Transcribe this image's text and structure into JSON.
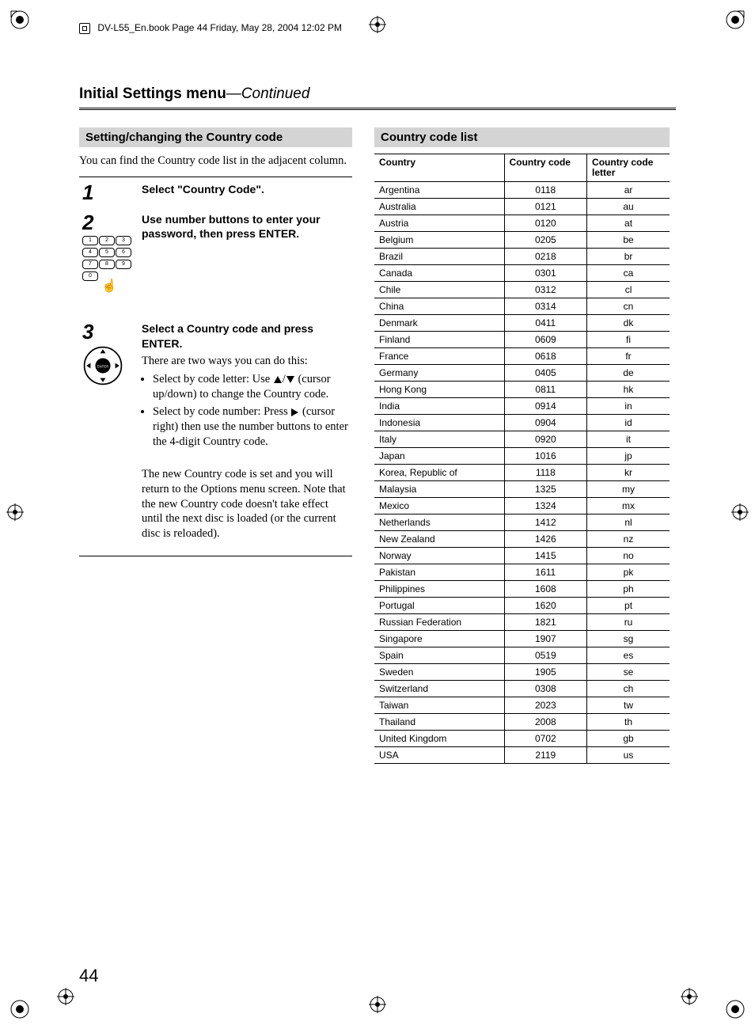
{
  "header_note": "DV-L55_En.book  Page 44  Friday, May 28, 2004  12:02 PM",
  "running_title_bold": "Initial Settings menu",
  "running_title_cont": "—Continued",
  "page_number": "44",
  "left": {
    "heading": "Setting/changing the Country code",
    "intro": "You can find the Country code list in the adjacent column.",
    "step1_num": "1",
    "step1_title": "Select \"Country Code\".",
    "step2_num": "2",
    "step2_title": "Use number buttons to enter your password, then press ENTER.",
    "step3_num": "3",
    "step3_title": "Select a Country code and press ENTER.",
    "step3_lead": "There are two ways you can do this:",
    "step3_b1_a": "Select by code letter: Use ",
    "step3_b1_b": " (cursor up/down) to change the Country code.",
    "step3_b2_a": "Select by code number: Press ",
    "step3_b2_b": " (cursor right) then use the number buttons to enter the 4-digit Country code.",
    "step3_para2": "The new Country code is set and you will return to the Options menu screen. Note that the new Country code doesn't take effect until the next disc is loaded (or the current disc is reloaded)."
  },
  "right": {
    "heading": "Country code list",
    "th1": "Country",
    "th2": "Country code",
    "th3": "Country code letter",
    "rows": [
      {
        "c": "Argentina",
        "n": "0118",
        "l": "ar"
      },
      {
        "c": "Australia",
        "n": "0121",
        "l": "au"
      },
      {
        "c": "Austria",
        "n": "0120",
        "l": "at"
      },
      {
        "c": "Belgium",
        "n": "0205",
        "l": "be"
      },
      {
        "c": "Brazil",
        "n": "0218",
        "l": "br"
      },
      {
        "c": "Canada",
        "n": "0301",
        "l": "ca"
      },
      {
        "c": "Chile",
        "n": "0312",
        "l": "cl"
      },
      {
        "c": "China",
        "n": "0314",
        "l": "cn"
      },
      {
        "c": "Denmark",
        "n": "0411",
        "l": "dk"
      },
      {
        "c": "Finland",
        "n": "0609",
        "l": "fi"
      },
      {
        "c": "France",
        "n": "0618",
        "l": "fr"
      },
      {
        "c": "Germany",
        "n": "0405",
        "l": "de"
      },
      {
        "c": "Hong Kong",
        "n": "0811",
        "l": "hk"
      },
      {
        "c": "India",
        "n": "0914",
        "l": "in"
      },
      {
        "c": "Indonesia",
        "n": "0904",
        "l": "id"
      },
      {
        "c": "Italy",
        "n": "0920",
        "l": "it"
      },
      {
        "c": "Japan",
        "n": "1016",
        "l": "jp"
      },
      {
        "c": "Korea, Republic of",
        "n": "1118",
        "l": "kr"
      },
      {
        "c": "Malaysia",
        "n": "1325",
        "l": "my"
      },
      {
        "c": "Mexico",
        "n": "1324",
        "l": "mx"
      },
      {
        "c": "Netherlands",
        "n": "1412",
        "l": "nl"
      },
      {
        "c": "New Zealand",
        "n": "1426",
        "l": "nz"
      },
      {
        "c": "Norway",
        "n": "1415",
        "l": "no"
      },
      {
        "c": "Pakistan",
        "n": "1611",
        "l": "pk"
      },
      {
        "c": "Philippines",
        "n": "1608",
        "l": "ph"
      },
      {
        "c": "Portugal",
        "n": "1620",
        "l": "pt"
      },
      {
        "c": "Russian Federation",
        "n": "1821",
        "l": "ru"
      },
      {
        "c": "Singapore",
        "n": "1907",
        "l": "sg"
      },
      {
        "c": "Spain",
        "n": "0519",
        "l": "es"
      },
      {
        "c": "Sweden",
        "n": "1905",
        "l": "se"
      },
      {
        "c": "Switzerland",
        "n": "0308",
        "l": "ch"
      },
      {
        "c": "Taiwan",
        "n": "2023",
        "l": "tw"
      },
      {
        "c": "Thailand",
        "n": "2008",
        "l": "th"
      },
      {
        "c": "United Kingdom",
        "n": "0702",
        "l": "gb"
      },
      {
        "c": "USA",
        "n": "2119",
        "l": "us"
      }
    ]
  }
}
